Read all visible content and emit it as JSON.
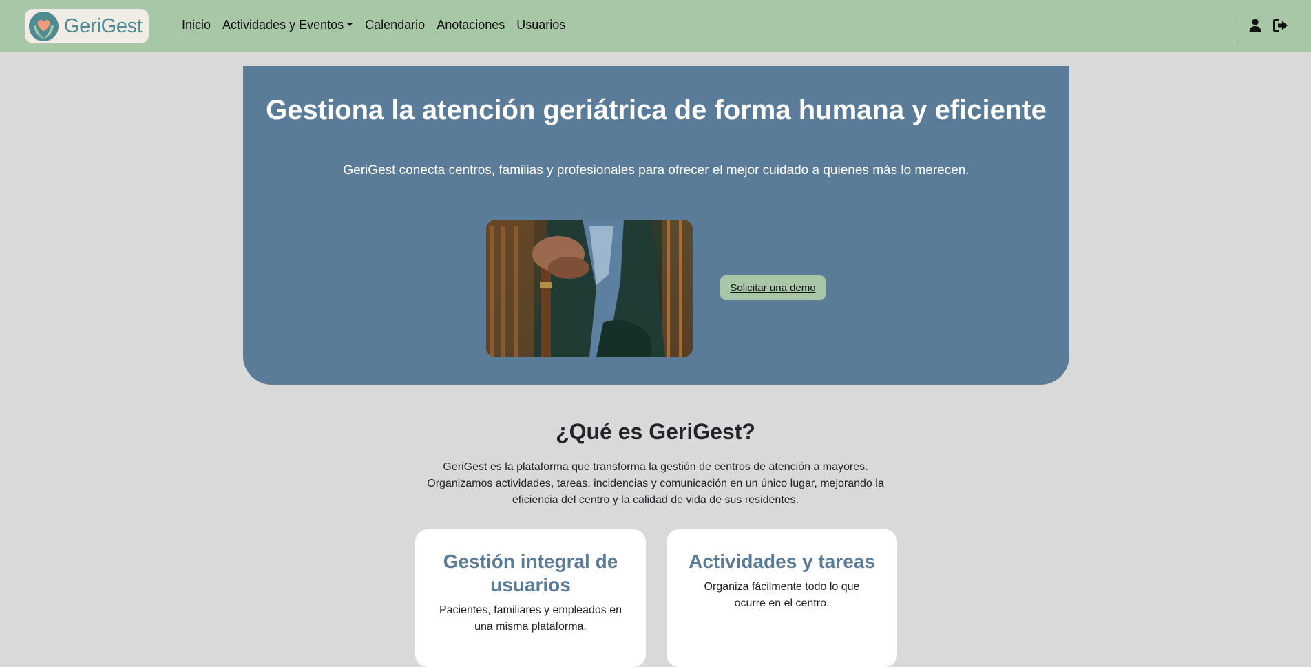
{
  "navbar": {
    "brand": "GeriGest",
    "links": [
      "Inicio",
      "Actividades y Eventos",
      "Calendario",
      "Anotaciones",
      "Usuarios"
    ],
    "user_icon": "user-icon",
    "logout_icon": "logout-icon",
    "accent_color": "#a7c7a7"
  },
  "hero": {
    "title": "Gestiona la atención geriátrica de forma humana y eficiente",
    "subtitle": "GeriGest conecta centros, familias y profesionales para ofrecer el mejor cuidado a quienes más lo merecen.",
    "cta_label": "Solicitar una demo",
    "background_color": "#5a7c99"
  },
  "about": {
    "title": "¿Qué es GeriGest?",
    "text": "GeriGest es la plataforma que transforma la gestión de centros de atención a mayores. Organizamos actividades, tareas, incidencias y comunicación en un único lugar, mejorando la eficiencia del centro y la calidad de vida de sus residentes."
  },
  "features": [
    {
      "title": "Gestión integral de usuarios",
      "text": "Pacientes, familiares y empleados en una misma plataforma."
    },
    {
      "title": "Actividades y tareas",
      "text": "Organiza fácilmente todo lo que ocurre en el centro."
    }
  ]
}
